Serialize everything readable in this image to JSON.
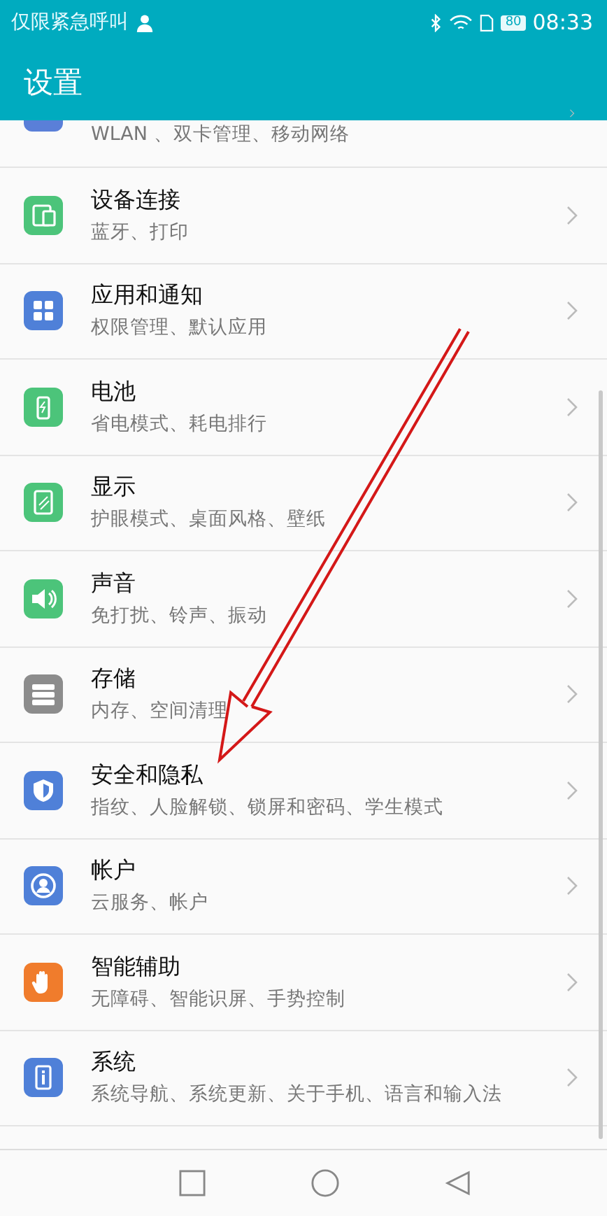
{
  "status_bar": {
    "carrier": "仅限紧急呼叫",
    "battery": "80",
    "time": "08:33"
  },
  "header": {
    "title": "设置"
  },
  "partial_item": {
    "subtitle": "WLAN 、双卡管理、移动网络",
    "color": "#5a7fd8"
  },
  "items": [
    {
      "title": "设备连接",
      "subtitle": "蓝牙、打印",
      "color": "#4cc47a"
    },
    {
      "title": "应用和通知",
      "subtitle": "权限管理、默认应用",
      "color": "#4f80d8"
    },
    {
      "title": "电池",
      "subtitle": "省电模式、耗电排行",
      "color": "#4cc47a"
    },
    {
      "title": "显示",
      "subtitle": "护眼模式、桌面风格、壁纸",
      "color": "#4cc47a"
    },
    {
      "title": "声音",
      "subtitle": "免打扰、铃声、振动",
      "color": "#4cc47a"
    },
    {
      "title": "存储",
      "subtitle": "内存、空间清理",
      "color": "#8c8c8c"
    },
    {
      "title": "安全和隐私",
      "subtitle": "指纹、人脸解锁、锁屏和密码、学生模式",
      "color": "#4f80d8"
    },
    {
      "title": "帐户",
      "subtitle": "云服务、帐户",
      "color": "#4f80d8"
    },
    {
      "title": "智能辅助",
      "subtitle": "无障碍、智能识屏、手势控制",
      "color": "#f07c2c"
    },
    {
      "title": "系统",
      "subtitle": "系统导航、系统更新、关于手机、语言和输入法",
      "color": "#4f80d8"
    }
  ]
}
